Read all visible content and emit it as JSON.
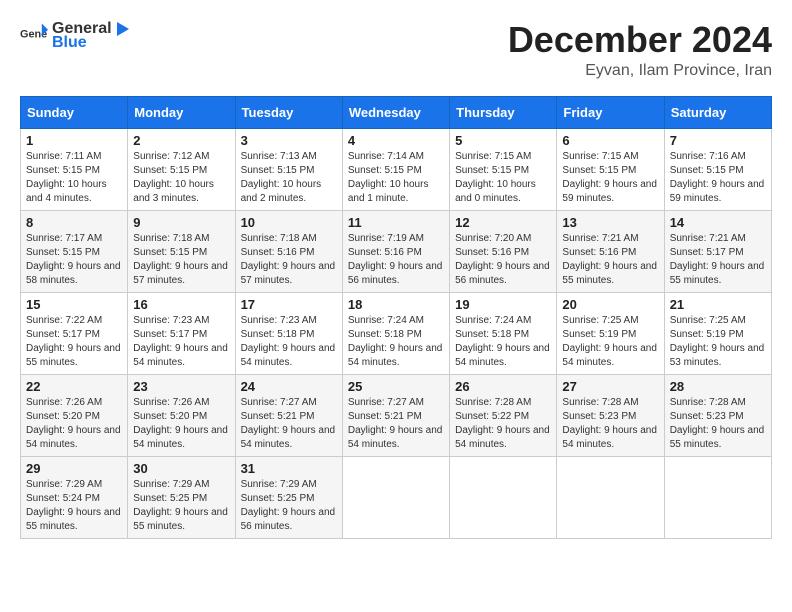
{
  "header": {
    "logo_general": "General",
    "logo_blue": "Blue",
    "month_title": "December 2024",
    "subtitle": "Eyvan, Ilam Province, Iran"
  },
  "weekdays": [
    "Sunday",
    "Monday",
    "Tuesday",
    "Wednesday",
    "Thursday",
    "Friday",
    "Saturday"
  ],
  "weeks": [
    [
      {
        "day": "1",
        "sunrise": "Sunrise: 7:11 AM",
        "sunset": "Sunset: 5:15 PM",
        "daylight": "Daylight: 10 hours and 4 minutes."
      },
      {
        "day": "2",
        "sunrise": "Sunrise: 7:12 AM",
        "sunset": "Sunset: 5:15 PM",
        "daylight": "Daylight: 10 hours and 3 minutes."
      },
      {
        "day": "3",
        "sunrise": "Sunrise: 7:13 AM",
        "sunset": "Sunset: 5:15 PM",
        "daylight": "Daylight: 10 hours and 2 minutes."
      },
      {
        "day": "4",
        "sunrise": "Sunrise: 7:14 AM",
        "sunset": "Sunset: 5:15 PM",
        "daylight": "Daylight: 10 hours and 1 minute."
      },
      {
        "day": "5",
        "sunrise": "Sunrise: 7:15 AM",
        "sunset": "Sunset: 5:15 PM",
        "daylight": "Daylight: 10 hours and 0 minutes."
      },
      {
        "day": "6",
        "sunrise": "Sunrise: 7:15 AM",
        "sunset": "Sunset: 5:15 PM",
        "daylight": "Daylight: 9 hours and 59 minutes."
      },
      {
        "day": "7",
        "sunrise": "Sunrise: 7:16 AM",
        "sunset": "Sunset: 5:15 PM",
        "daylight": "Daylight: 9 hours and 59 minutes."
      }
    ],
    [
      {
        "day": "8",
        "sunrise": "Sunrise: 7:17 AM",
        "sunset": "Sunset: 5:15 PM",
        "daylight": "Daylight: 9 hours and 58 minutes."
      },
      {
        "day": "9",
        "sunrise": "Sunrise: 7:18 AM",
        "sunset": "Sunset: 5:15 PM",
        "daylight": "Daylight: 9 hours and 57 minutes."
      },
      {
        "day": "10",
        "sunrise": "Sunrise: 7:18 AM",
        "sunset": "Sunset: 5:16 PM",
        "daylight": "Daylight: 9 hours and 57 minutes."
      },
      {
        "day": "11",
        "sunrise": "Sunrise: 7:19 AM",
        "sunset": "Sunset: 5:16 PM",
        "daylight": "Daylight: 9 hours and 56 minutes."
      },
      {
        "day": "12",
        "sunrise": "Sunrise: 7:20 AM",
        "sunset": "Sunset: 5:16 PM",
        "daylight": "Daylight: 9 hours and 56 minutes."
      },
      {
        "day": "13",
        "sunrise": "Sunrise: 7:21 AM",
        "sunset": "Sunset: 5:16 PM",
        "daylight": "Daylight: 9 hours and 55 minutes."
      },
      {
        "day": "14",
        "sunrise": "Sunrise: 7:21 AM",
        "sunset": "Sunset: 5:17 PM",
        "daylight": "Daylight: 9 hours and 55 minutes."
      }
    ],
    [
      {
        "day": "15",
        "sunrise": "Sunrise: 7:22 AM",
        "sunset": "Sunset: 5:17 PM",
        "daylight": "Daylight: 9 hours and 55 minutes."
      },
      {
        "day": "16",
        "sunrise": "Sunrise: 7:23 AM",
        "sunset": "Sunset: 5:17 PM",
        "daylight": "Daylight: 9 hours and 54 minutes."
      },
      {
        "day": "17",
        "sunrise": "Sunrise: 7:23 AM",
        "sunset": "Sunset: 5:18 PM",
        "daylight": "Daylight: 9 hours and 54 minutes."
      },
      {
        "day": "18",
        "sunrise": "Sunrise: 7:24 AM",
        "sunset": "Sunset: 5:18 PM",
        "daylight": "Daylight: 9 hours and 54 minutes."
      },
      {
        "day": "19",
        "sunrise": "Sunrise: 7:24 AM",
        "sunset": "Sunset: 5:18 PM",
        "daylight": "Daylight: 9 hours and 54 minutes."
      },
      {
        "day": "20",
        "sunrise": "Sunrise: 7:25 AM",
        "sunset": "Sunset: 5:19 PM",
        "daylight": "Daylight: 9 hours and 54 minutes."
      },
      {
        "day": "21",
        "sunrise": "Sunrise: 7:25 AM",
        "sunset": "Sunset: 5:19 PM",
        "daylight": "Daylight: 9 hours and 53 minutes."
      }
    ],
    [
      {
        "day": "22",
        "sunrise": "Sunrise: 7:26 AM",
        "sunset": "Sunset: 5:20 PM",
        "daylight": "Daylight: 9 hours and 54 minutes."
      },
      {
        "day": "23",
        "sunrise": "Sunrise: 7:26 AM",
        "sunset": "Sunset: 5:20 PM",
        "daylight": "Daylight: 9 hours and 54 minutes."
      },
      {
        "day": "24",
        "sunrise": "Sunrise: 7:27 AM",
        "sunset": "Sunset: 5:21 PM",
        "daylight": "Daylight: 9 hours and 54 minutes."
      },
      {
        "day": "25",
        "sunrise": "Sunrise: 7:27 AM",
        "sunset": "Sunset: 5:21 PM",
        "daylight": "Daylight: 9 hours and 54 minutes."
      },
      {
        "day": "26",
        "sunrise": "Sunrise: 7:28 AM",
        "sunset": "Sunset: 5:22 PM",
        "daylight": "Daylight: 9 hours and 54 minutes."
      },
      {
        "day": "27",
        "sunrise": "Sunrise: 7:28 AM",
        "sunset": "Sunset: 5:23 PM",
        "daylight": "Daylight: 9 hours and 54 minutes."
      },
      {
        "day": "28",
        "sunrise": "Sunrise: 7:28 AM",
        "sunset": "Sunset: 5:23 PM",
        "daylight": "Daylight: 9 hours and 55 minutes."
      }
    ],
    [
      {
        "day": "29",
        "sunrise": "Sunrise: 7:29 AM",
        "sunset": "Sunset: 5:24 PM",
        "daylight": "Daylight: 9 hours and 55 minutes."
      },
      {
        "day": "30",
        "sunrise": "Sunrise: 7:29 AM",
        "sunset": "Sunset: 5:25 PM",
        "daylight": "Daylight: 9 hours and 55 minutes."
      },
      {
        "day": "31",
        "sunrise": "Sunrise: 7:29 AM",
        "sunset": "Sunset: 5:25 PM",
        "daylight": "Daylight: 9 hours and 56 minutes."
      },
      null,
      null,
      null,
      null
    ]
  ]
}
